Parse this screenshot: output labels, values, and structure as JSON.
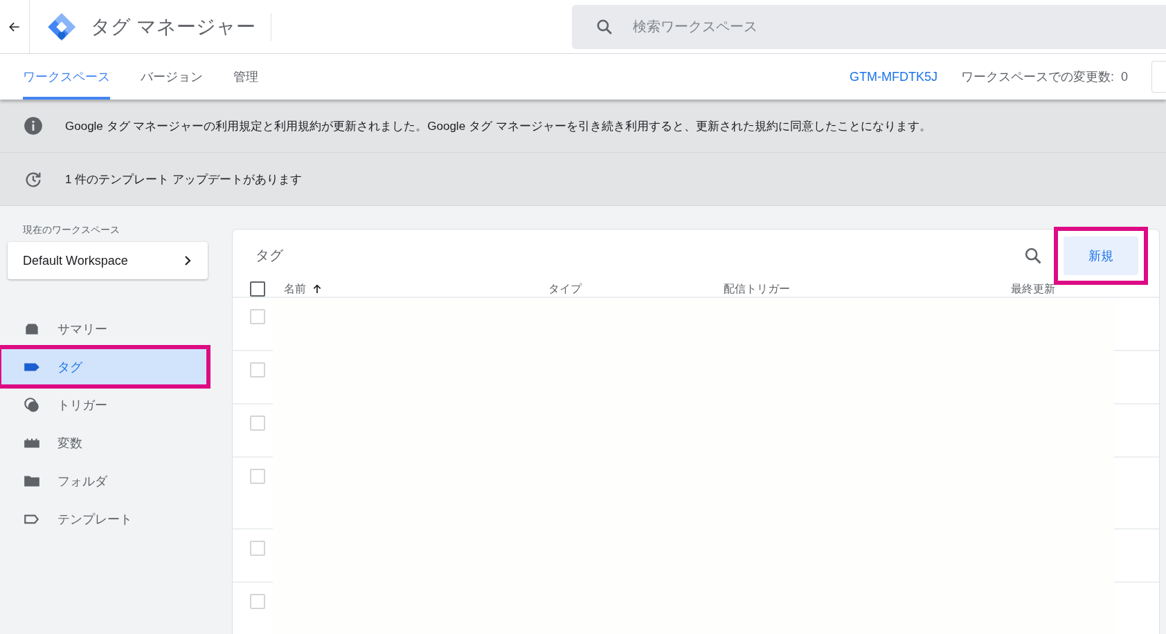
{
  "header": {
    "title": "タグ マネージャー",
    "search": {
      "placeholder": "検索ワークスペース"
    }
  },
  "tabs": [
    {
      "label": "ワークスペース",
      "selected": true
    },
    {
      "label": "バージョン",
      "selected": false
    },
    {
      "label": "管理",
      "selected": false
    }
  ],
  "container_id": "GTM-MFDTK5J",
  "changes": "ワークスペースでの変更数:  0",
  "banners": [
    {
      "kind": "info",
      "text": "Google タグ マネージャーの利用規定と利用規約が更新されました。Google タグ マネージャーを引き続き利用すると、更新された規約に同意したことになります。"
    },
    {
      "kind": "update",
      "text": "1 件のテンプレート アップデートがあります"
    }
  ],
  "sidebar": {
    "workspace_label": "現在のワークスペース",
    "workspace": "Default Workspace",
    "items": [
      {
        "kind": "summary",
        "label": "サマリー",
        "selected": false,
        "highlighted": false
      },
      {
        "kind": "tag",
        "label": "タグ",
        "selected": true,
        "highlighted": true
      },
      {
        "kind": "trigger",
        "label": "トリガー",
        "selected": false,
        "highlighted": false
      },
      {
        "kind": "variable",
        "label": "変数",
        "selected": false,
        "highlighted": false
      },
      {
        "kind": "folder",
        "label": "フォルダ",
        "selected": false,
        "highlighted": false
      },
      {
        "kind": "template",
        "label": "テンプレート",
        "selected": false,
        "highlighted": false
      }
    ]
  },
  "panel": {
    "title": "タグ",
    "new_button": {
      "label": "新規",
      "highlighted": true
    },
    "select_all_checked": false,
    "columns": [
      "名前",
      "タイプ",
      "配信トリガー",
      "最終更新"
    ],
    "rows": [
      {
        "checked": false
      },
      {
        "checked": false
      },
      {
        "checked": false
      },
      {
        "checked": false
      },
      {
        "checked": false
      },
      {
        "checked": false
      }
    ]
  }
}
